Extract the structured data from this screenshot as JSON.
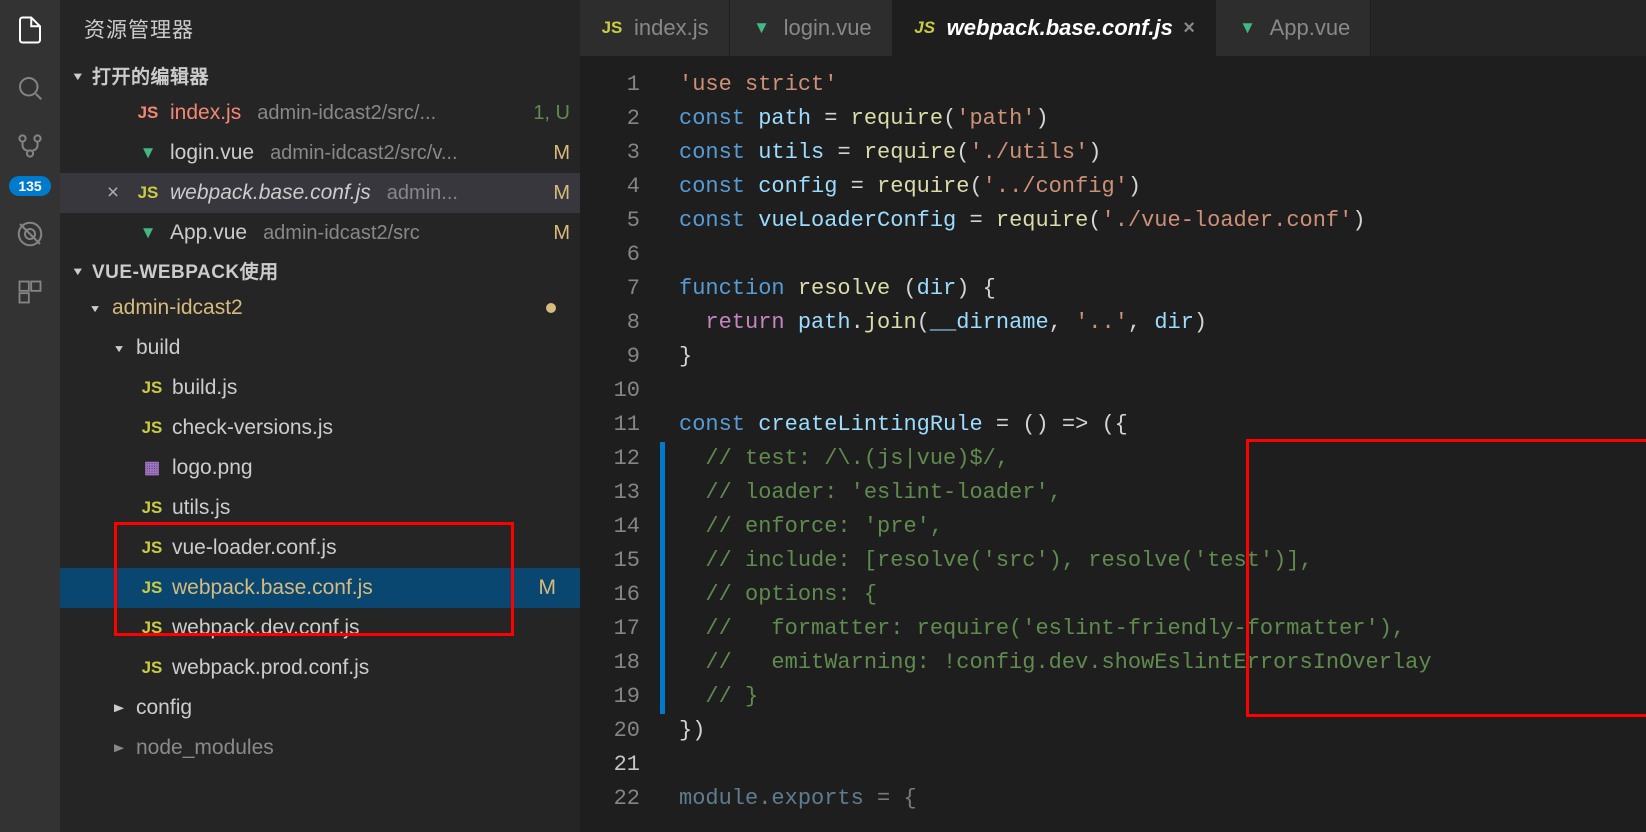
{
  "activityBar": {
    "badge": "135"
  },
  "sidebar": {
    "title": "资源管理器",
    "openEditors": {
      "header": "打开的编辑器",
      "items": [
        {
          "icon": "js",
          "name": "index.js",
          "path": "admin-idcast2/src/...",
          "status": "1, U",
          "red": true
        },
        {
          "icon": "vue",
          "name": "login.vue",
          "path": "admin-idcast2/src/v...",
          "status": "M"
        },
        {
          "icon": "js",
          "name": "webpack.base.conf.js",
          "path": "admin...",
          "status": "M",
          "active": true,
          "italic": true,
          "showClose": true
        },
        {
          "icon": "vue",
          "name": "App.vue",
          "path": "admin-idcast2/src",
          "status": "M"
        }
      ]
    },
    "workspace": {
      "header": "VUE-WEBPACK使用",
      "tree": [
        {
          "label": "admin-idcast2",
          "depth": 1,
          "folder": true,
          "expanded": true,
          "modDot": true,
          "mod": true
        },
        {
          "label": "build",
          "depth": 2,
          "folder": true,
          "expanded": true
        },
        {
          "label": "build.js",
          "depth": 3,
          "icon": "js"
        },
        {
          "label": "check-versions.js",
          "depth": 3,
          "icon": "js"
        },
        {
          "label": "logo.png",
          "depth": 3,
          "icon": "img"
        },
        {
          "label": "utils.js",
          "depth": 3,
          "icon": "js"
        },
        {
          "label": "vue-loader.conf.js",
          "depth": 3,
          "icon": "js"
        },
        {
          "label": "webpack.base.conf.js",
          "depth": 3,
          "icon": "js",
          "selected": true,
          "mod": true,
          "statusLetter": "M"
        },
        {
          "label": "webpack.dev.conf.js",
          "depth": 3,
          "icon": "js"
        },
        {
          "label": "webpack.prod.conf.js",
          "depth": 3,
          "icon": "js"
        },
        {
          "label": "config",
          "depth": 2,
          "folder": true,
          "expanded": false
        },
        {
          "label": "node_modules",
          "depth": 2,
          "folder": true,
          "expanded": false,
          "dim": true
        }
      ]
    }
  },
  "tabs": [
    {
      "icon": "js",
      "label": "index.js"
    },
    {
      "icon": "vue",
      "label": "login.vue"
    },
    {
      "icon": "js",
      "label": "webpack.base.conf.js",
      "active": true,
      "close": true
    },
    {
      "icon": "vue",
      "label": "App.vue"
    }
  ],
  "code": {
    "lines": [
      {
        "n": 1,
        "html": "<span class='str'>'use strict'</span>"
      },
      {
        "n": 2,
        "html": "<span class='kw'>const</span> <span class='var'>path</span> <span class='pun'>=</span> <span class='fn'>require</span><span class='pun'>(</span><span class='str'>'path'</span><span class='pun'>)</span>"
      },
      {
        "n": 3,
        "html": "<span class='kw'>const</span> <span class='var'>utils</span> <span class='pun'>=</span> <span class='fn'>require</span><span class='pun'>(</span><span class='str'>'./utils'</span><span class='pun'>)</span>"
      },
      {
        "n": 4,
        "html": "<span class='kw'>const</span> <span class='var'>config</span> <span class='pun'>=</span> <span class='fn'>require</span><span class='pun'>(</span><span class='str'>'../config'</span><span class='pun'>)</span>"
      },
      {
        "n": 5,
        "html": "<span class='kw'>const</span> <span class='var'>vueLoaderConfig</span> <span class='pun'>=</span> <span class='fn'>require</span><span class='pun'>(</span><span class='str'>'./vue-loader.conf'</span><span class='pun'>)</span>"
      },
      {
        "n": 6,
        "html": ""
      },
      {
        "n": 7,
        "html": "<span class='kw'>function</span> <span class='fn'>resolve</span> <span class='pun'>(</span><span class='var'>dir</span><span class='pun'>) {</span>"
      },
      {
        "n": 8,
        "html": "  <span class='kw2'>return</span> <span class='var'>path</span><span class='pun'>.</span><span class='fn'>join</span><span class='pun'>(</span><span class='var'>__dirname</span><span class='pun'>,</span> <span class='str'>'..'</span><span class='pun'>,</span> <span class='var'>dir</span><span class='pun'>)</span>"
      },
      {
        "n": 9,
        "html": "<span class='pun'>}</span>"
      },
      {
        "n": 10,
        "html": ""
      },
      {
        "n": 11,
        "html": "<span class='kw'>const</span> <span class='var'>createLintingRule</span> <span class='pun'>= () =&gt; ({</span>"
      },
      {
        "n": 12,
        "html": "  <span class='cmt'>// test: /\\.(js|vue)$/,</span>",
        "mod": true
      },
      {
        "n": 13,
        "html": "  <span class='cmt'>// loader: 'eslint-loader',</span>",
        "mod": true
      },
      {
        "n": 14,
        "html": "  <span class='cmt'>// enforce: 'pre',</span>",
        "mod": true
      },
      {
        "n": 15,
        "html": "  <span class='cmt'>// include: [resolve('src'), resolve('test')],</span>",
        "mod": true
      },
      {
        "n": 16,
        "html": "  <span class='cmt'>// options: {</span>",
        "mod": true
      },
      {
        "n": 17,
        "html": "  <span class='cmt'>//   formatter: require('eslint-friendly-formatter'),</span>",
        "mod": true
      },
      {
        "n": 18,
        "html": "  <span class='cmt'>//   emitWarning: !config.dev.showEslintErrorsInOverlay</span>",
        "mod": true
      },
      {
        "n": 19,
        "html": "  <span class='cmt'>// }</span>",
        "mod": true
      },
      {
        "n": 20,
        "html": "<span class='pun'>})</span>"
      },
      {
        "n": 21,
        "html": "",
        "active": true
      },
      {
        "n": 22,
        "html": "<span class='var'>module</span><span class='pun'>.</span><span class='var'>exports</span> <span class='pun'>= {</span>",
        "dim": true
      }
    ]
  }
}
